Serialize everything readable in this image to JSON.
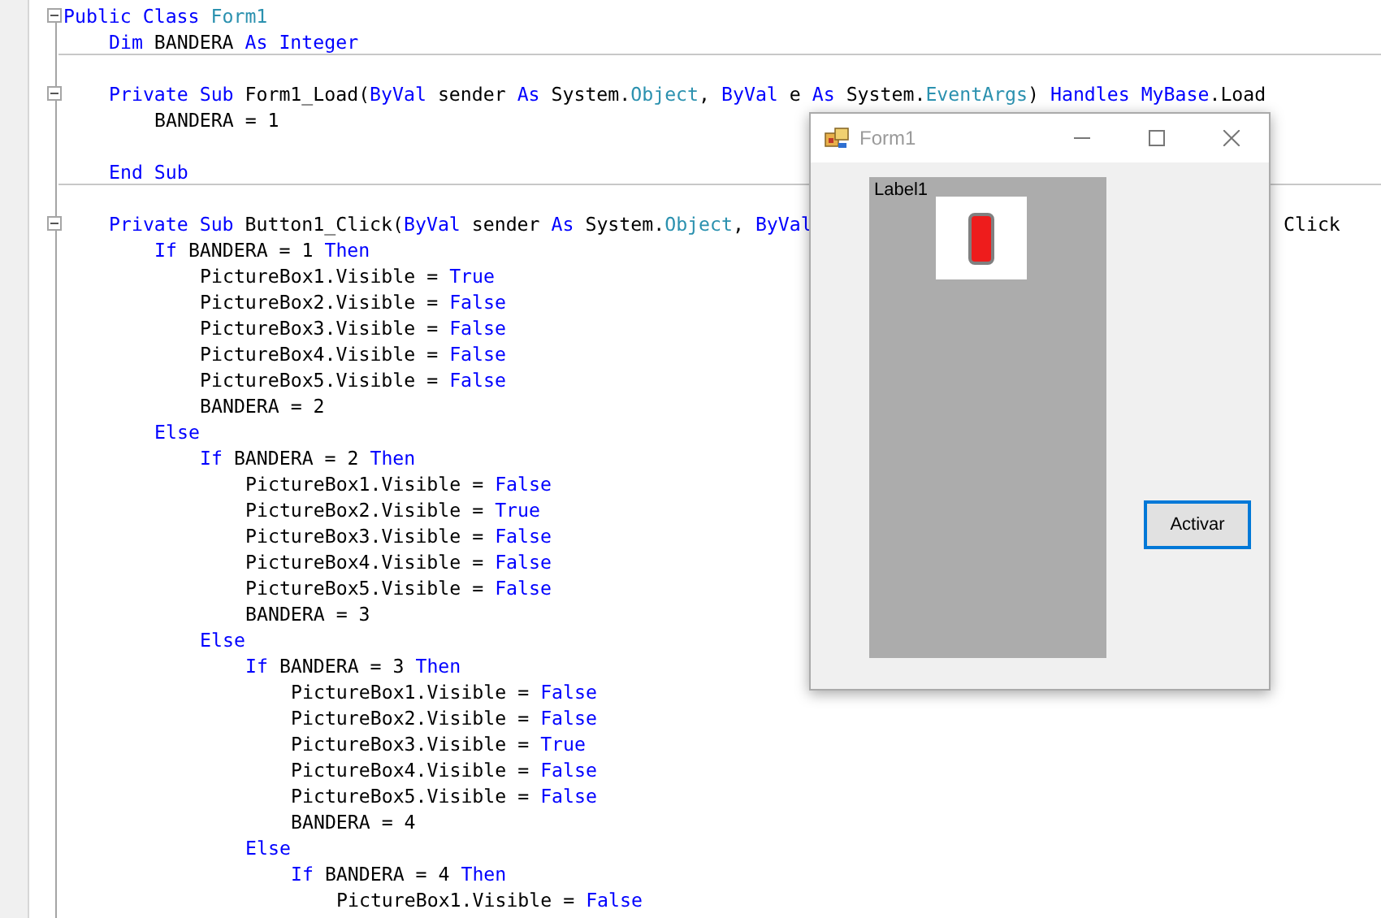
{
  "editor": {
    "lines": [
      {
        "kind": "code",
        "fold": true,
        "separator_below": false,
        "tokens": [
          {
            "kind": "keyword",
            "text": "Public Class "
          },
          {
            "kind": "type",
            "text": "Form1"
          }
        ],
        "children": [
          {
            "kind": "code",
            "fold": false,
            "separator_below": true,
            "tokens": [
              {
                "kind": "keyword",
                "text": "Dim "
              },
              {
                "kind": "plain",
                "text": "BANDERA "
              },
              {
                "kind": "keyword",
                "text": "As Integer"
              }
            ]
          },
          {
            "kind": "blank",
            "fold": false,
            "separator_below": false
          },
          {
            "kind": "code",
            "fold": true,
            "separator_below": false,
            "tokens": [
              {
                "kind": "keyword",
                "text": "Private Sub "
              },
              {
                "kind": "plain",
                "text": "Form1_Load("
              },
              {
                "kind": "keyword",
                "text": "ByVal "
              },
              {
                "kind": "plain",
                "text": "sender "
              },
              {
                "kind": "keyword",
                "text": "As "
              },
              {
                "kind": "plain",
                "text": "System."
              },
              {
                "kind": "type",
                "text": "Object"
              },
              {
                "kind": "plain",
                "text": ", "
              },
              {
                "kind": "keyword",
                "text": "ByVal "
              },
              {
                "kind": "plain",
                "text": "e "
              },
              {
                "kind": "keyword",
                "text": "As "
              },
              {
                "kind": "plain",
                "text": "System."
              },
              {
                "kind": "type",
                "text": "EventArgs"
              },
              {
                "kind": "plain",
                "text": ") "
              },
              {
                "kind": "keyword",
                "text": "Handles "
              },
              {
                "kind": "keyword",
                "text": "MyBase"
              },
              {
                "kind": "plain",
                "text": ".Load"
              }
            ],
            "children": [
              {
                "kind": "code",
                "fold": false,
                "separator_below": false,
                "tokens": [
                  {
                    "kind": "plain",
                    "text": "BANDERA = 1"
                  }
                ]
              },
              {
                "kind": "blank",
                "fold": false,
                "separator_below": false
              }
            ]
          },
          {
            "kind": "code",
            "fold": false,
            "separator_below": true,
            "tokens": [
              {
                "kind": "keyword",
                "text": "End Sub"
              }
            ]
          },
          {
            "kind": "blank",
            "fold": false,
            "separator_below": false
          },
          {
            "kind": "code",
            "fold": true,
            "separator_below": false,
            "tokens": [
              {
                "kind": "keyword",
                "text": "Private Sub "
              },
              {
                "kind": "plain",
                "text": "Button1_Click("
              },
              {
                "kind": "keyword",
                "text": "ByVal "
              },
              {
                "kind": "plain",
                "text": "sender "
              },
              {
                "kind": "keyword",
                "text": "As "
              },
              {
                "kind": "plain",
                "text": "System."
              },
              {
                "kind": "type",
                "text": "Object"
              },
              {
                "kind": "plain",
                "text": ", "
              },
              {
                "kind": "keyword",
                "text": "ByVal"
              }
            ],
            "tail": {
              "kind": "plain",
              "text": "Click"
            },
            "children": [
              {
                "kind": "code",
                "fold": false,
                "separator_below": false,
                "tokens": [
                  {
                    "kind": "keyword",
                    "text": "If "
                  },
                  {
                    "kind": "plain",
                    "text": "BANDERA = 1 "
                  },
                  {
                    "kind": "keyword",
                    "text": "Then"
                  }
                ],
                "children": [
                  {
                    "kind": "code",
                    "fold": false,
                    "separator_below": false,
                    "tokens": [
                      {
                        "kind": "plain",
                        "text": "PictureBox1.Visible = "
                      },
                      {
                        "kind": "keyword",
                        "text": "True"
                      }
                    ]
                  },
                  {
                    "kind": "code",
                    "fold": false,
                    "separator_below": false,
                    "tokens": [
                      {
                        "kind": "plain",
                        "text": "PictureBox2.Visible = "
                      },
                      {
                        "kind": "keyword",
                        "text": "False"
                      }
                    ]
                  },
                  {
                    "kind": "code",
                    "fold": false,
                    "separator_below": false,
                    "tokens": [
                      {
                        "kind": "plain",
                        "text": "PictureBox3.Visible = "
                      },
                      {
                        "kind": "keyword",
                        "text": "False"
                      }
                    ]
                  },
                  {
                    "kind": "code",
                    "fold": false,
                    "separator_below": false,
                    "tokens": [
                      {
                        "kind": "plain",
                        "text": "PictureBox4.Visible = "
                      },
                      {
                        "kind": "keyword",
                        "text": "False"
                      }
                    ]
                  },
                  {
                    "kind": "code",
                    "fold": false,
                    "separator_below": false,
                    "tokens": [
                      {
                        "kind": "plain",
                        "text": "PictureBox5.Visible = "
                      },
                      {
                        "kind": "keyword",
                        "text": "False"
                      }
                    ]
                  },
                  {
                    "kind": "code",
                    "fold": false,
                    "separator_below": false,
                    "tokens": [
                      {
                        "kind": "plain",
                        "text": "BANDERA = 2"
                      }
                    ]
                  }
                ]
              },
              {
                "kind": "code",
                "fold": false,
                "separator_below": false,
                "tokens": [
                  {
                    "kind": "keyword",
                    "text": "Else"
                  }
                ],
                "children": [
                  {
                    "kind": "code",
                    "fold": false,
                    "separator_below": false,
                    "tokens": [
                      {
                        "kind": "keyword",
                        "text": "If "
                      },
                      {
                        "kind": "plain",
                        "text": "BANDERA = 2 "
                      },
                      {
                        "kind": "keyword",
                        "text": "Then"
                      }
                    ],
                    "children": [
                      {
                        "kind": "code",
                        "fold": false,
                        "separator_below": false,
                        "tokens": [
                          {
                            "kind": "plain",
                            "text": "PictureBox1.Visible = "
                          },
                          {
                            "kind": "keyword",
                            "text": "False"
                          }
                        ]
                      },
                      {
                        "kind": "code",
                        "fold": false,
                        "separator_below": false,
                        "tokens": [
                          {
                            "kind": "plain",
                            "text": "PictureBox2.Visible = "
                          },
                          {
                            "kind": "keyword",
                            "text": "True"
                          }
                        ]
                      },
                      {
                        "kind": "code",
                        "fold": false,
                        "separator_below": false,
                        "tokens": [
                          {
                            "kind": "plain",
                            "text": "PictureBox3.Visible = "
                          },
                          {
                            "kind": "keyword",
                            "text": "False"
                          }
                        ]
                      },
                      {
                        "kind": "code",
                        "fold": false,
                        "separator_below": false,
                        "tokens": [
                          {
                            "kind": "plain",
                            "text": "PictureBox4.Visible = "
                          },
                          {
                            "kind": "keyword",
                            "text": "False"
                          }
                        ]
                      },
                      {
                        "kind": "code",
                        "fold": false,
                        "separator_below": false,
                        "tokens": [
                          {
                            "kind": "plain",
                            "text": "PictureBox5.Visible = "
                          },
                          {
                            "kind": "keyword",
                            "text": "False"
                          }
                        ]
                      },
                      {
                        "kind": "code",
                        "fold": false,
                        "separator_below": false,
                        "tokens": [
                          {
                            "kind": "plain",
                            "text": "BANDERA = 3"
                          }
                        ]
                      }
                    ]
                  },
                  {
                    "kind": "code",
                    "fold": false,
                    "separator_below": false,
                    "tokens": [
                      {
                        "kind": "keyword",
                        "text": "Else"
                      }
                    ],
                    "children": [
                      {
                        "kind": "code",
                        "fold": false,
                        "separator_below": false,
                        "tokens": [
                          {
                            "kind": "keyword",
                            "text": "If "
                          },
                          {
                            "kind": "plain",
                            "text": "BANDERA = 3 "
                          },
                          {
                            "kind": "keyword",
                            "text": "Then"
                          }
                        ],
                        "children": [
                          {
                            "kind": "code",
                            "fold": false,
                            "separator_below": false,
                            "tokens": [
                              {
                                "kind": "plain",
                                "text": "PictureBox1.Visible = "
                              },
                              {
                                "kind": "keyword",
                                "text": "False"
                              }
                            ]
                          },
                          {
                            "kind": "code",
                            "fold": false,
                            "separator_below": false,
                            "tokens": [
                              {
                                "kind": "plain",
                                "text": "PictureBox2.Visible = "
                              },
                              {
                                "kind": "keyword",
                                "text": "False"
                              }
                            ]
                          },
                          {
                            "kind": "code",
                            "fold": false,
                            "separator_below": false,
                            "tokens": [
                              {
                                "kind": "plain",
                                "text": "PictureBox3.Visible = "
                              },
                              {
                                "kind": "keyword",
                                "text": "True"
                              }
                            ]
                          },
                          {
                            "kind": "code",
                            "fold": false,
                            "separator_below": false,
                            "tokens": [
                              {
                                "kind": "plain",
                                "text": "PictureBox4.Visible = "
                              },
                              {
                                "kind": "keyword",
                                "text": "False"
                              }
                            ]
                          },
                          {
                            "kind": "code",
                            "fold": false,
                            "separator_below": false,
                            "tokens": [
                              {
                                "kind": "plain",
                                "text": "PictureBox5.Visible = "
                              },
                              {
                                "kind": "keyword",
                                "text": "False"
                              }
                            ]
                          },
                          {
                            "kind": "code",
                            "fold": false,
                            "separator_below": false,
                            "tokens": [
                              {
                                "kind": "plain",
                                "text": "BANDERA = 4"
                              }
                            ]
                          }
                        ]
                      },
                      {
                        "kind": "code",
                        "fold": false,
                        "separator_below": false,
                        "tokens": [
                          {
                            "kind": "keyword",
                            "text": "Else"
                          }
                        ],
                        "children": [
                          {
                            "kind": "code",
                            "fold": false,
                            "separator_below": false,
                            "tokens": [
                              {
                                "kind": "keyword",
                                "text": "If "
                              },
                              {
                                "kind": "plain",
                                "text": "BANDERA = 4 "
                              },
                              {
                                "kind": "keyword",
                                "text": "Then"
                              }
                            ],
                            "children": [
                              {
                                "kind": "code",
                                "fold": false,
                                "separator_below": false,
                                "tokens": [
                                  {
                                    "kind": "plain",
                                    "text": "PictureBox1.Visible = "
                                  },
                                  {
                                    "kind": "keyword",
                                    "text": "False"
                                  }
                                ]
                              }
                            ]
                          }
                        ]
                      }
                    ]
                  }
                ]
              }
            ]
          }
        ]
      }
    ]
  },
  "window": {
    "title": "Form1",
    "label": "Label1",
    "button": {
      "label": "Activar",
      "focused": true
    }
  }
}
